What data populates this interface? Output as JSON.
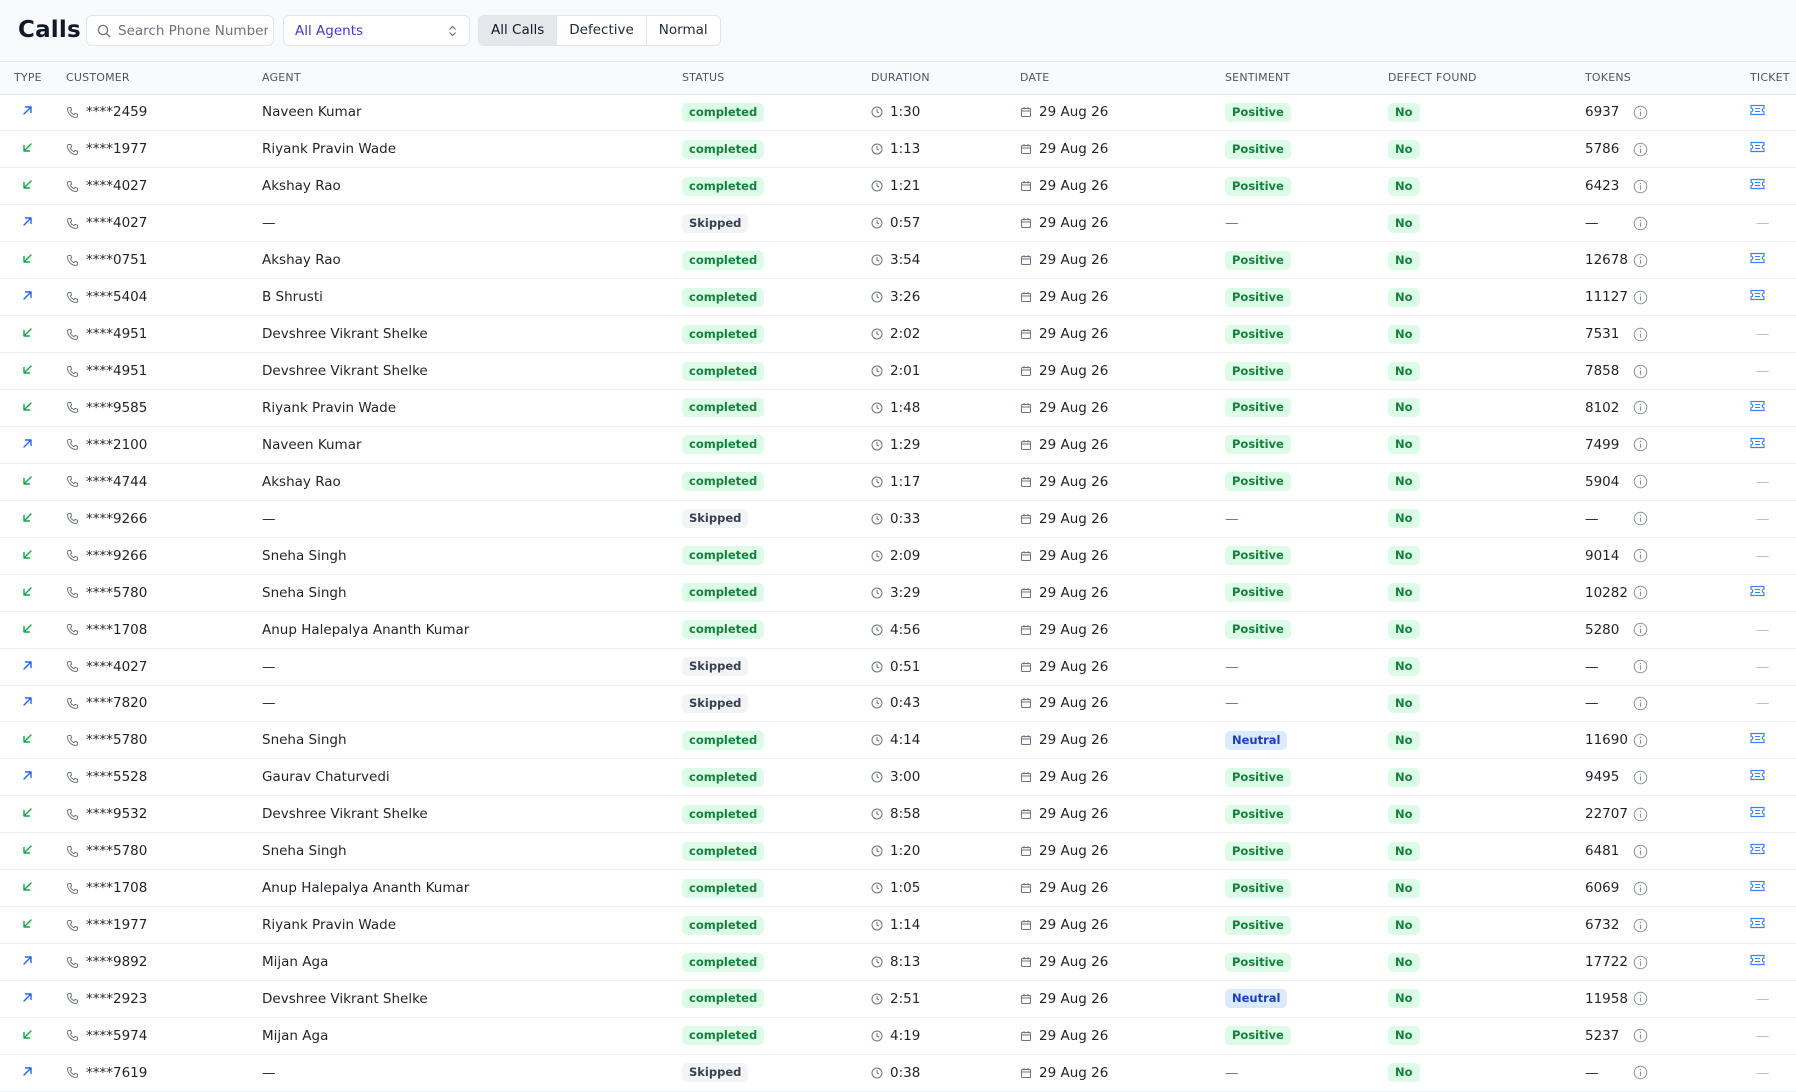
{
  "header": {
    "title": "Calls",
    "search_placeholder": "Search Phone Number",
    "agent_select": "All Agents",
    "filters": [
      "All Calls",
      "Defective",
      "Normal"
    ],
    "active_filter": 0
  },
  "table": {
    "columns": [
      "Type",
      "Customer",
      "Agent",
      "Status",
      "Duration",
      "Date",
      "Sentiment",
      "Defect Found",
      "Tokens",
      "Ticket"
    ],
    "rows": [
      {
        "type": "outbound",
        "customer": "****2459",
        "agent": "Naveen Kumar",
        "status": "completed",
        "duration": "1:30",
        "date": "29 Aug 26",
        "sentiment": "Positive",
        "defect": "No",
        "tokens": "6937",
        "ticket": true
      },
      {
        "type": "inbound",
        "customer": "****1977",
        "agent": "Riyank Pravin Wade",
        "status": "completed",
        "duration": "1:13",
        "date": "29 Aug 26",
        "sentiment": "Positive",
        "defect": "No",
        "tokens": "5786",
        "ticket": true
      },
      {
        "type": "inbound",
        "customer": "****4027",
        "agent": "Akshay Rao",
        "status": "completed",
        "duration": "1:21",
        "date": "29 Aug 26",
        "sentiment": "Positive",
        "defect": "No",
        "tokens": "6423",
        "ticket": true
      },
      {
        "type": "outbound",
        "customer": "****4027",
        "agent": "—",
        "status": "Skipped",
        "duration": "0:57",
        "date": "29 Aug 26",
        "sentiment": "—",
        "defect": "No",
        "tokens": "—",
        "ticket": false
      },
      {
        "type": "inbound",
        "customer": "****0751",
        "agent": "Akshay Rao",
        "status": "completed",
        "duration": "3:54",
        "date": "29 Aug 26",
        "sentiment": "Positive",
        "defect": "No",
        "tokens": "12678",
        "ticket": true
      },
      {
        "type": "outbound",
        "customer": "****5404",
        "agent": "B Shrusti",
        "status": "completed",
        "duration": "3:26",
        "date": "29 Aug 26",
        "sentiment": "Positive",
        "defect": "No",
        "tokens": "11127",
        "ticket": true
      },
      {
        "type": "inbound",
        "customer": "****4951",
        "agent": "Devshree Vikrant Shelke",
        "status": "completed",
        "duration": "2:02",
        "date": "29 Aug 26",
        "sentiment": "Positive",
        "defect": "No",
        "tokens": "7531",
        "ticket": false
      },
      {
        "type": "inbound",
        "customer": "****4951",
        "agent": "Devshree Vikrant Shelke",
        "status": "completed",
        "duration": "2:01",
        "date": "29 Aug 26",
        "sentiment": "Positive",
        "defect": "No",
        "tokens": "7858",
        "ticket": false
      },
      {
        "type": "inbound",
        "customer": "****9585",
        "agent": "Riyank Pravin Wade",
        "status": "completed",
        "duration": "1:48",
        "date": "29 Aug 26",
        "sentiment": "Positive",
        "defect": "No",
        "tokens": "8102",
        "ticket": true
      },
      {
        "type": "outbound",
        "customer": "****2100",
        "agent": "Naveen Kumar",
        "status": "completed",
        "duration": "1:29",
        "date": "29 Aug 26",
        "sentiment": "Positive",
        "defect": "No",
        "tokens": "7499",
        "ticket": true
      },
      {
        "type": "inbound",
        "customer": "****4744",
        "agent": "Akshay Rao",
        "status": "completed",
        "duration": "1:17",
        "date": "29 Aug 26",
        "sentiment": "Positive",
        "defect": "No",
        "tokens": "5904",
        "ticket": false
      },
      {
        "type": "inbound",
        "customer": "****9266",
        "agent": "—",
        "status": "Skipped",
        "duration": "0:33",
        "date": "29 Aug 26",
        "sentiment": "—",
        "defect": "No",
        "tokens": "—",
        "ticket": false
      },
      {
        "type": "inbound",
        "customer": "****9266",
        "agent": "Sneha Singh",
        "status": "completed",
        "duration": "2:09",
        "date": "29 Aug 26",
        "sentiment": "Positive",
        "defect": "No",
        "tokens": "9014",
        "ticket": false
      },
      {
        "type": "inbound",
        "customer": "****5780",
        "agent": "Sneha Singh",
        "status": "completed",
        "duration": "3:29",
        "date": "29 Aug 26",
        "sentiment": "Positive",
        "defect": "No",
        "tokens": "10282",
        "ticket": true
      },
      {
        "type": "inbound",
        "customer": "****1708",
        "agent": "Anup Halepalya Ananth Kumar",
        "status": "completed",
        "duration": "4:56",
        "date": "29 Aug 26",
        "sentiment": "Positive",
        "defect": "No",
        "tokens": "5280",
        "ticket": false
      },
      {
        "type": "outbound",
        "customer": "****4027",
        "agent": "—",
        "status": "Skipped",
        "duration": "0:51",
        "date": "29 Aug 26",
        "sentiment": "—",
        "defect": "No",
        "tokens": "—",
        "ticket": false
      },
      {
        "type": "outbound",
        "customer": "****7820",
        "agent": "—",
        "status": "Skipped",
        "duration": "0:43",
        "date": "29 Aug 26",
        "sentiment": "—",
        "defect": "No",
        "tokens": "—",
        "ticket": false
      },
      {
        "type": "inbound",
        "customer": "****5780",
        "agent": "Sneha Singh",
        "status": "completed",
        "duration": "4:14",
        "date": "29 Aug 26",
        "sentiment": "Neutral",
        "defect": "No",
        "tokens": "11690",
        "ticket": true
      },
      {
        "type": "outbound",
        "customer": "****5528",
        "agent": "Gaurav Chaturvedi",
        "status": "completed",
        "duration": "3:00",
        "date": "29 Aug 26",
        "sentiment": "Positive",
        "defect": "No",
        "tokens": "9495",
        "ticket": true
      },
      {
        "type": "inbound",
        "customer": "****9532",
        "agent": "Devshree Vikrant Shelke",
        "status": "completed",
        "duration": "8:58",
        "date": "29 Aug 26",
        "sentiment": "Positive",
        "defect": "No",
        "tokens": "22707",
        "ticket": true
      },
      {
        "type": "inbound",
        "customer": "****5780",
        "agent": "Sneha Singh",
        "status": "completed",
        "duration": "1:20",
        "date": "29 Aug 26",
        "sentiment": "Positive",
        "defect": "No",
        "tokens": "6481",
        "ticket": true
      },
      {
        "type": "inbound",
        "customer": "****1708",
        "agent": "Anup Halepalya Ananth Kumar",
        "status": "completed",
        "duration": "1:05",
        "date": "29 Aug 26",
        "sentiment": "Positive",
        "defect": "No",
        "tokens": "6069",
        "ticket": true
      },
      {
        "type": "inbound",
        "customer": "****1977",
        "agent": "Riyank Pravin Wade",
        "status": "completed",
        "duration": "1:14",
        "date": "29 Aug 26",
        "sentiment": "Positive",
        "defect": "No",
        "tokens": "6732",
        "ticket": true
      },
      {
        "type": "outbound",
        "customer": "****9892",
        "agent": "Mijan Aga",
        "status": "completed",
        "duration": "8:13",
        "date": "29 Aug 26",
        "sentiment": "Positive",
        "defect": "No",
        "tokens": "17722",
        "ticket": true
      },
      {
        "type": "outbound",
        "customer": "****2923",
        "agent": "Devshree Vikrant Shelke",
        "status": "completed",
        "duration": "2:51",
        "date": "29 Aug 26",
        "sentiment": "Neutral",
        "defect": "No",
        "tokens": "11958",
        "ticket": false
      },
      {
        "type": "inbound",
        "customer": "****5974",
        "agent": "Mijan Aga",
        "status": "completed",
        "duration": "4:19",
        "date": "29 Aug 26",
        "sentiment": "Positive",
        "defect": "No",
        "tokens": "5237",
        "ticket": false
      },
      {
        "type": "outbound",
        "customer": "****7619",
        "agent": "—",
        "status": "Skipped",
        "duration": "0:38",
        "date": "29 Aug 26",
        "sentiment": "—",
        "defect": "No",
        "tokens": "—",
        "ticket": false
      }
    ]
  },
  "colors": {
    "inbound_arrow": "#16a34a",
    "outbound_arrow": "#2563eb",
    "accent": "#4338ca",
    "ticket_icon": "#3b82f6"
  },
  "icons": {
    "search": "search-icon",
    "select": "chevron-updown-icon",
    "phone": "phone-icon",
    "clock": "clock-icon",
    "calendar": "calendar-icon",
    "info": "info-icon",
    "ticket": "ticket-icon"
  }
}
